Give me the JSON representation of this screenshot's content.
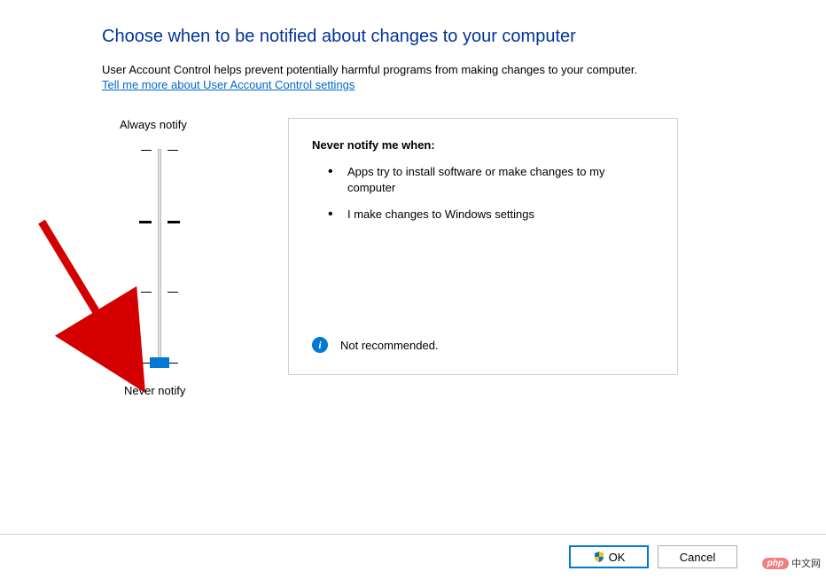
{
  "title": "Choose when to be notified about changes to your computer",
  "subtitle": "User Account Control helps prevent potentially harmful programs from making changes to your computer.",
  "link_text": "Tell me more about User Account Control settings",
  "slider": {
    "top_label": "Always notify",
    "bottom_label": "Never notify"
  },
  "panel": {
    "heading": "Never notify me when:",
    "items": [
      "Apps try to install software or make changes to my computer",
      "I make changes to Windows settings"
    ],
    "note": "Not recommended."
  },
  "buttons": {
    "ok": "OK",
    "cancel": "Cancel"
  },
  "watermark": {
    "badge": "php",
    "text": "中文网"
  }
}
